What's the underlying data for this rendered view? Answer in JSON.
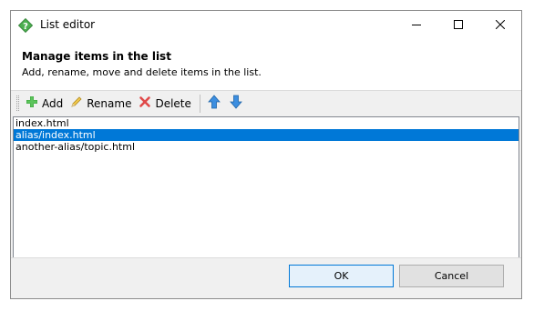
{
  "window": {
    "title": "List editor",
    "app_icon": "question-diamond-icon"
  },
  "titlebar_buttons": {
    "minimize_icon": "minimize-icon",
    "maximize_icon": "maximize-icon",
    "close_icon": "close-icon"
  },
  "header": {
    "title": "Manage items in the list",
    "subtitle": "Add, rename, move and delete items in the list."
  },
  "toolbar": {
    "add_label": "Add",
    "rename_label": "Rename",
    "delete_label": "Delete",
    "add_icon": "plus-icon",
    "rename_icon": "pencil-icon",
    "delete_icon": "x-icon",
    "move_up_icon": "arrow-up-icon",
    "move_down_icon": "arrow-down-icon"
  },
  "list": {
    "items": [
      {
        "label": "index.html",
        "selected": false
      },
      {
        "label": "alias/index.html",
        "selected": true
      },
      {
        "label": "another-alias/topic.html",
        "selected": false
      }
    ]
  },
  "footer": {
    "ok_label": "OK",
    "cancel_label": "Cancel"
  },
  "colors": {
    "selection": "#0078d7",
    "add_green": "#3aa53a",
    "delete_red": "#e04848",
    "arrow_blue": "#3c8ee0",
    "app_icon_green": "#4caf50"
  }
}
